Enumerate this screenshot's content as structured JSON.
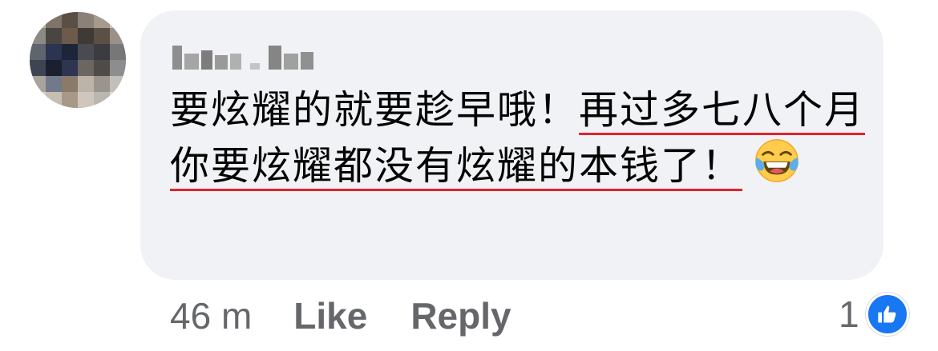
{
  "comment": {
    "author": "",
    "text_before_underline": "要炫耀的就要趁早哦！",
    "text_underlined": "再过多七八个月你要炫耀都没有炫耀的本钱了！",
    "emoji": "face-with-tears-of-joy",
    "timestamp": "46 m",
    "like_label": "Like",
    "reply_label": "Reply",
    "reaction_count": "1",
    "reaction_type": "like-icon"
  },
  "colors": {
    "bubble": "#f0f2f5",
    "underline": "#e0242e",
    "meta_text": "#65676b",
    "like_badge": "#1877f2"
  }
}
